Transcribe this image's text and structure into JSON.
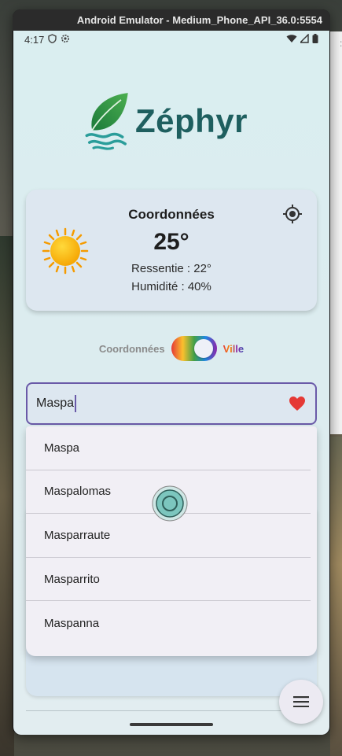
{
  "window": {
    "title": "Android Emulator - Medium_Phone_API_36.0:5554"
  },
  "status_bar": {
    "time": "4:17"
  },
  "app": {
    "logo_text": "Zéphyr"
  },
  "weather": {
    "title": "Coordonnées",
    "temperature": "25°",
    "feels_like": "Ressentie : 22°",
    "humidity": "Humidité : 40%"
  },
  "mode_toggle": {
    "left_label": "Coordonnées",
    "right_label": "Ville",
    "selected": "Ville"
  },
  "search": {
    "value": "Maspa"
  },
  "suggestions": [
    "Maspa",
    "Maspalomas",
    "Masparraute",
    "Masparrito",
    "Maspanna"
  ],
  "colors": {
    "accent": "#6a5aa8",
    "brand": "#1e5f5f",
    "favorite": "#e53935"
  }
}
